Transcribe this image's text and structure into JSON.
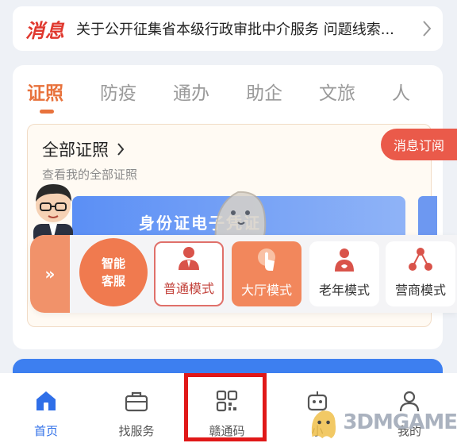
{
  "notice": {
    "tag": "消息",
    "text": "关于公开征集省本级行政审批中介服务 问题线索..."
  },
  "tabs": [
    "证照",
    "防疫",
    "通办",
    "助企",
    "文旅",
    "人"
  ],
  "certificates": {
    "title": "全部证照",
    "subtitle": "查看我的全部证照",
    "card_label": "身份证电子凭证",
    "subscribe_label": "消息订阅"
  },
  "modes": {
    "expand_label": "»",
    "smart_service": [
      "智能",
      "客服"
    ],
    "items": [
      {
        "label": "普通模式",
        "icon": "person-icon"
      },
      {
        "label": "大厅模式",
        "icon": "touch-icon"
      },
      {
        "label": "老年模式",
        "icon": "elder-icon"
      },
      {
        "label": "营商模式",
        "icon": "share-icon"
      }
    ]
  },
  "bottom_nav": [
    {
      "label": "首页",
      "icon": "home-icon",
      "active": true
    },
    {
      "label": "找服务",
      "icon": "briefcase-icon",
      "active": false
    },
    {
      "label": "赣通码",
      "icon": "qrcode-icon",
      "active": false
    },
    {
      "label": "小",
      "icon": "robot-icon",
      "active": false
    },
    {
      "label": "我的",
      "icon": "user-icon",
      "active": false
    }
  ],
  "watermark": "3DMGAME",
  "colors": {
    "accent": "#e8723c",
    "red": "#e0382e",
    "blue": "#2f6fe8",
    "highlight": "#e01818"
  }
}
